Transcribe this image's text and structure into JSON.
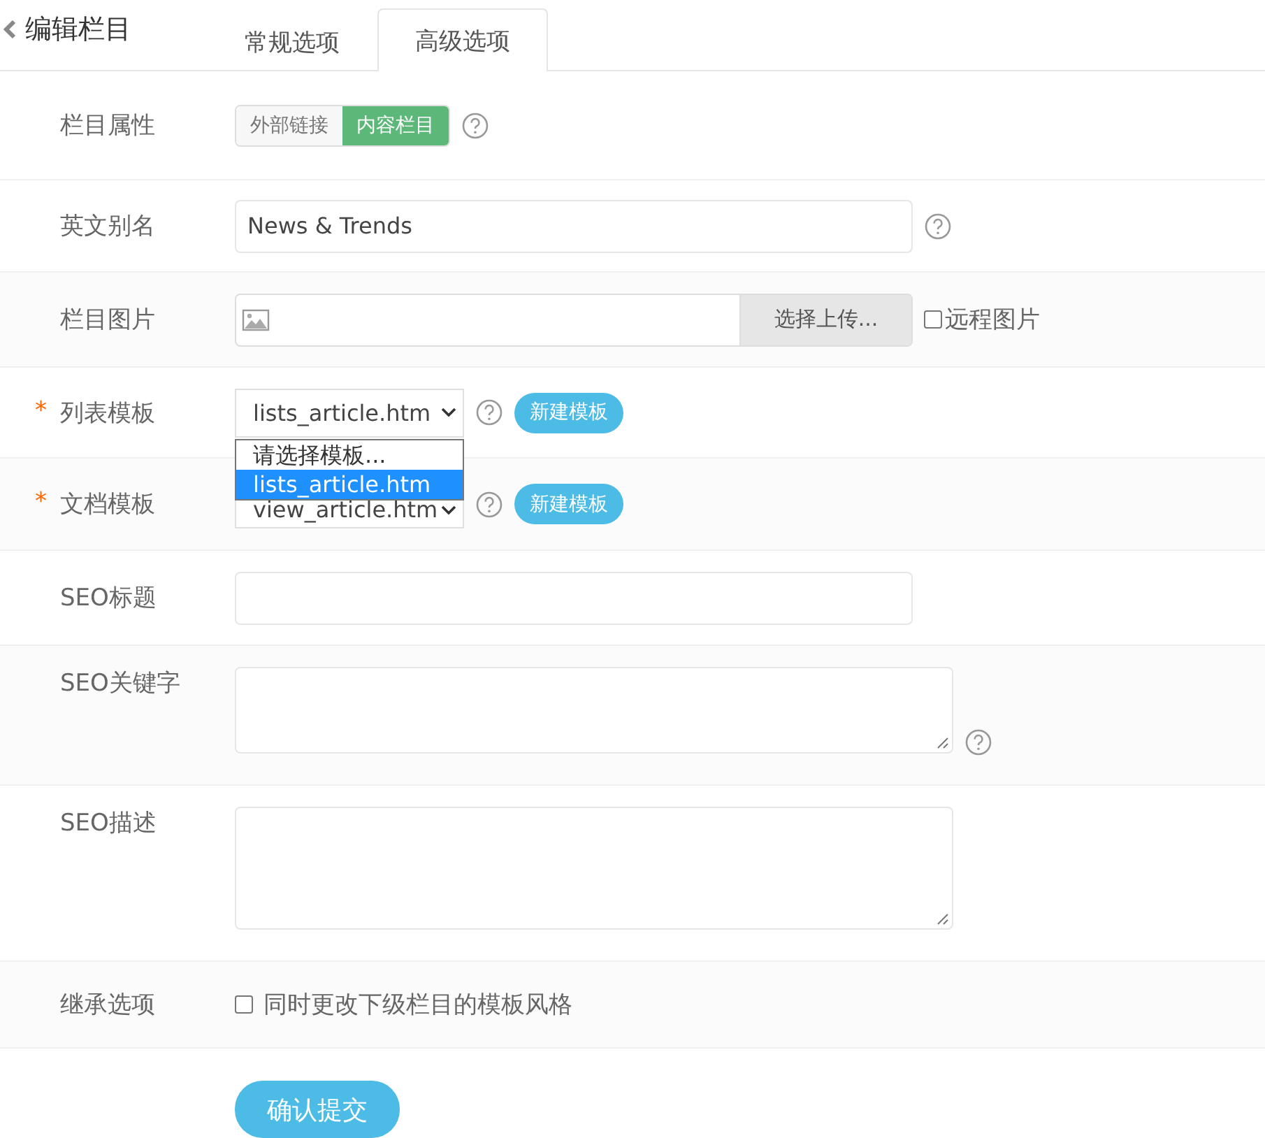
{
  "header": {
    "back_title": "编辑栏目"
  },
  "tabs": [
    {
      "label": "常规选项",
      "selected": false
    },
    {
      "label": "高级选项",
      "selected": true
    }
  ],
  "rows": [
    {
      "kind": "toggle",
      "label": "栏目属性",
      "help": true,
      "options": [
        {
          "label": "外部链接",
          "selected": false
        },
        {
          "label": "内容栏目",
          "selected": true
        }
      ]
    },
    {
      "kind": "text",
      "label": "英文别名",
      "help": true,
      "value": "News & Trends"
    },
    {
      "kind": "image",
      "label": "栏目图片",
      "help": false,
      "button": "选择上传...",
      "extra": {
        "label": "远程图片",
        "checked": false
      }
    },
    {
      "kind": "select",
      "label": "列表模板",
      "marker": "*",
      "help": true,
      "value": "lists_article.htm",
      "action": "新建模板",
      "open": true,
      "options": [
        {
          "label": "请选择模板...",
          "selected": false
        },
        {
          "label": "lists_article.htm",
          "selected": true
        }
      ]
    },
    {
      "kind": "select",
      "label": "文档模板",
      "marker": "*",
      "help": true,
      "value": "view_article.htm",
      "action": "新建模板",
      "open": false
    },
    {
      "kind": "text",
      "label": "SEO标题",
      "help": false
    },
    {
      "kind": "textarea",
      "label": "SEO关键字",
      "help": true
    },
    {
      "kind": "textarea",
      "label": "SEO描述",
      "help": false
    },
    {
      "kind": "checkbox",
      "label": "继承选项",
      "help": false,
      "extra": {
        "label": "同时更改下级栏目的模板风格",
        "checked": false
      }
    }
  ],
  "submit": "确认提交"
}
